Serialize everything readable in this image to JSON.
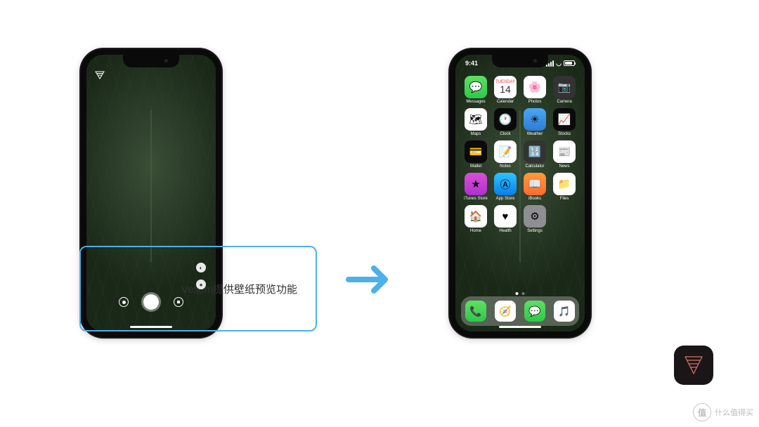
{
  "callout": {
    "text": "Vellum提供壁纸预览功能"
  },
  "status": {
    "time": "9:41"
  },
  "apps": {
    "row1": [
      {
        "label": "Messages",
        "ic": "i-msg",
        "g": "💬"
      },
      {
        "label": "Calendar",
        "ic": "i-cal",
        "g": ""
      },
      {
        "label": "Photos",
        "ic": "i-pho",
        "g": "🌸"
      },
      {
        "label": "Camera",
        "ic": "i-cam",
        "g": "📷"
      }
    ],
    "row2": [
      {
        "label": "Maps",
        "ic": "i-map",
        "g": "🗺"
      },
      {
        "label": "Clock",
        "ic": "i-clk",
        "g": "🕐"
      },
      {
        "label": "Weather",
        "ic": "i-wea",
        "g": "☀"
      },
      {
        "label": "Stocks",
        "ic": "i-stk",
        "g": "📈"
      }
    ],
    "row3": [
      {
        "label": "Wallet",
        "ic": "i-wal",
        "g": "💳"
      },
      {
        "label": "Notes",
        "ic": "i-not",
        "g": "📝"
      },
      {
        "label": "Calculator",
        "ic": "i-calc",
        "g": "🔢"
      },
      {
        "label": "News",
        "ic": "i-news",
        "g": "📰"
      }
    ],
    "row4": [
      {
        "label": "iTunes Store",
        "ic": "i-itu",
        "g": "★"
      },
      {
        "label": "App Store",
        "ic": "i-aps",
        "g": "Ⓐ"
      },
      {
        "label": "iBooks",
        "ic": "i-bok",
        "g": "📖"
      },
      {
        "label": "Files",
        "ic": "i-fil",
        "g": "📁"
      }
    ],
    "row5": [
      {
        "label": "Home",
        "ic": "i-hom",
        "g": "🏠"
      },
      {
        "label": "Health",
        "ic": "i-hea",
        "g": "♥"
      },
      {
        "label": "Settings",
        "ic": "i-set",
        "g": "⚙"
      }
    ],
    "dock": [
      {
        "ic": "i-pho2",
        "g": "📞"
      },
      {
        "ic": "i-saf",
        "g": "🧭"
      },
      {
        "ic": "i-sms",
        "g": "💬"
      },
      {
        "ic": "i-mus",
        "g": "🎵"
      }
    ]
  },
  "calendar": {
    "day": "TUESDAY",
    "date": "14"
  },
  "watermark": {
    "symbol": "值",
    "text": "什么值得买"
  }
}
